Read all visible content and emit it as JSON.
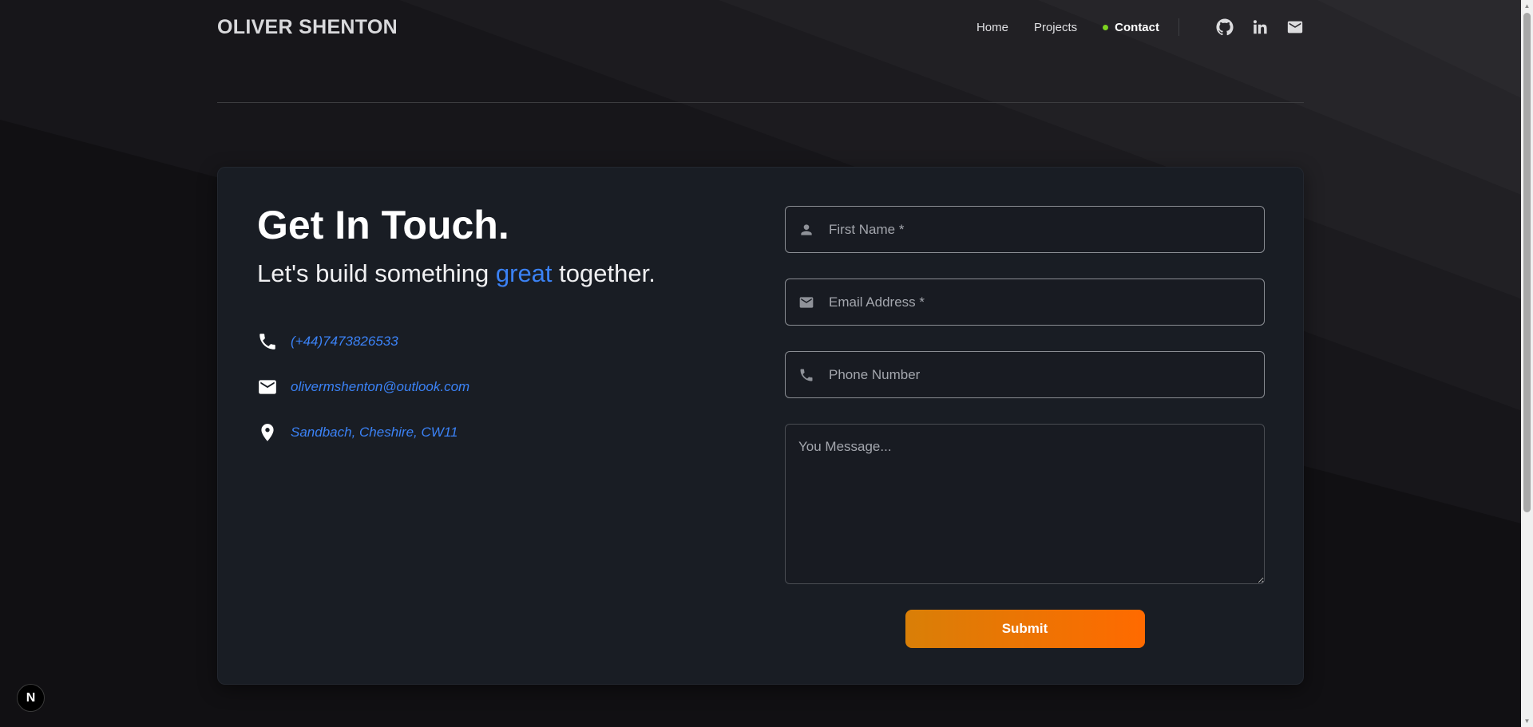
{
  "header": {
    "brand": "OLIVER SHENTON",
    "nav": [
      {
        "label": "Home"
      },
      {
        "label": "Projects"
      },
      {
        "label": "Contact"
      }
    ]
  },
  "social_icons": [
    "github-icon",
    "linkedin-icon",
    "mail-icon"
  ],
  "contact": {
    "title": "Get In Touch.",
    "tagline_before": "Let's build something ",
    "tagline_accent": "great",
    "tagline_after": " together.",
    "phone": "(+44)7473826533",
    "email": "olivermshenton@outlook.com",
    "location": "Sandbach, Cheshire, CW11"
  },
  "form": {
    "first_name_placeholder": "First Name *",
    "email_placeholder": "Email Address *",
    "phone_placeholder": "Phone Number",
    "message_placeholder": "You Message...",
    "submit_label": "Submit"
  },
  "badge": "N",
  "colors": {
    "accent_blue": "#3b82f6",
    "active_dot": "#7ed321",
    "submit_start": "#d97f07",
    "submit_end": "#ff6a00",
    "card_bg": "#191d24"
  }
}
